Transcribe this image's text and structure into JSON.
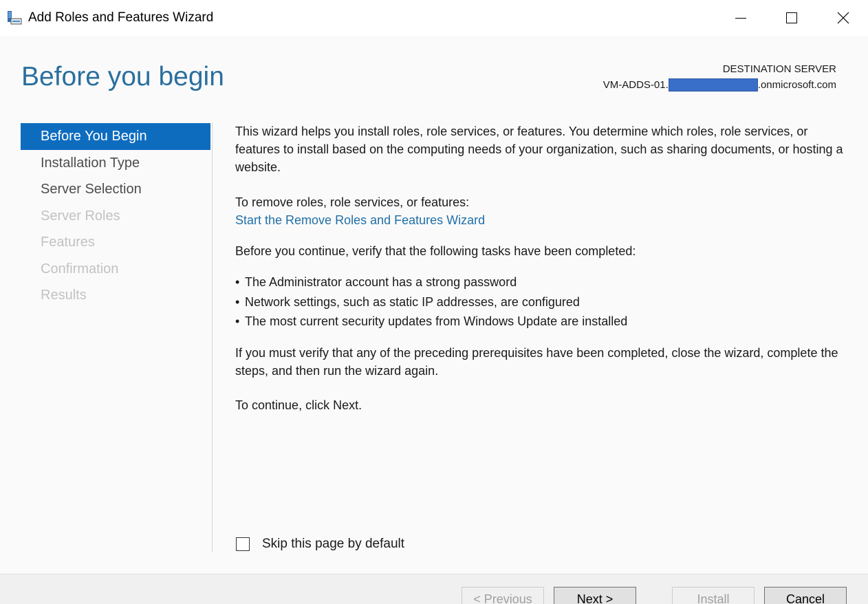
{
  "window": {
    "title": "Add Roles and Features Wizard",
    "icon": "server-manager-icon",
    "controls": {
      "minimize": "minimize-icon",
      "maximize": "maximize-icon",
      "close": "close-icon"
    }
  },
  "header": {
    "heading": "Before you begin",
    "destination_label": "DESTINATION SERVER",
    "server_prefix": "VM-ADDS-01.",
    "server_suffix": ".onmicrosoft.com"
  },
  "nav": {
    "items": [
      {
        "label": "Before You Begin",
        "state": "active"
      },
      {
        "label": "Installation Type",
        "state": "enabled"
      },
      {
        "label": "Server Selection",
        "state": "enabled"
      },
      {
        "label": "Server Roles",
        "state": "disabled"
      },
      {
        "label": "Features",
        "state": "disabled"
      },
      {
        "label": "Confirmation",
        "state": "disabled"
      },
      {
        "label": "Results",
        "state": "disabled"
      }
    ]
  },
  "content": {
    "intro": "This wizard helps you install roles, role services, or features. You determine which roles, role services, or features to install based on the computing needs of your organization, such as sharing documents, or hosting a website.",
    "remove_label": "To remove roles, role services, or features:",
    "remove_link": "Start the Remove Roles and Features Wizard",
    "tasks_label": "Before you continue, verify that the following tasks have been completed:",
    "bullet_char": "•",
    "bullets": [
      "The Administrator account has a strong password",
      "Network settings, such as static IP addresses, are configured",
      "The most current security updates from Windows Update are installed"
    ],
    "verify": "If you must verify that any of the preceding prerequisites have been completed, close the wizard, complete the steps, and then run the wizard again.",
    "continue": "To continue, click Next."
  },
  "skip": {
    "label": "Skip this page by default",
    "checked": false
  },
  "footer": {
    "previous_label": "< Previous",
    "next_label": "Next >",
    "install_label": "Install",
    "cancel_label": "Cancel"
  },
  "colors": {
    "accent": "#0e6cbf",
    "heading": "#2a6f9e",
    "link": "#1f6fa8",
    "disabled_text": "#c2c2c2",
    "redaction": "#3a6fc9"
  }
}
